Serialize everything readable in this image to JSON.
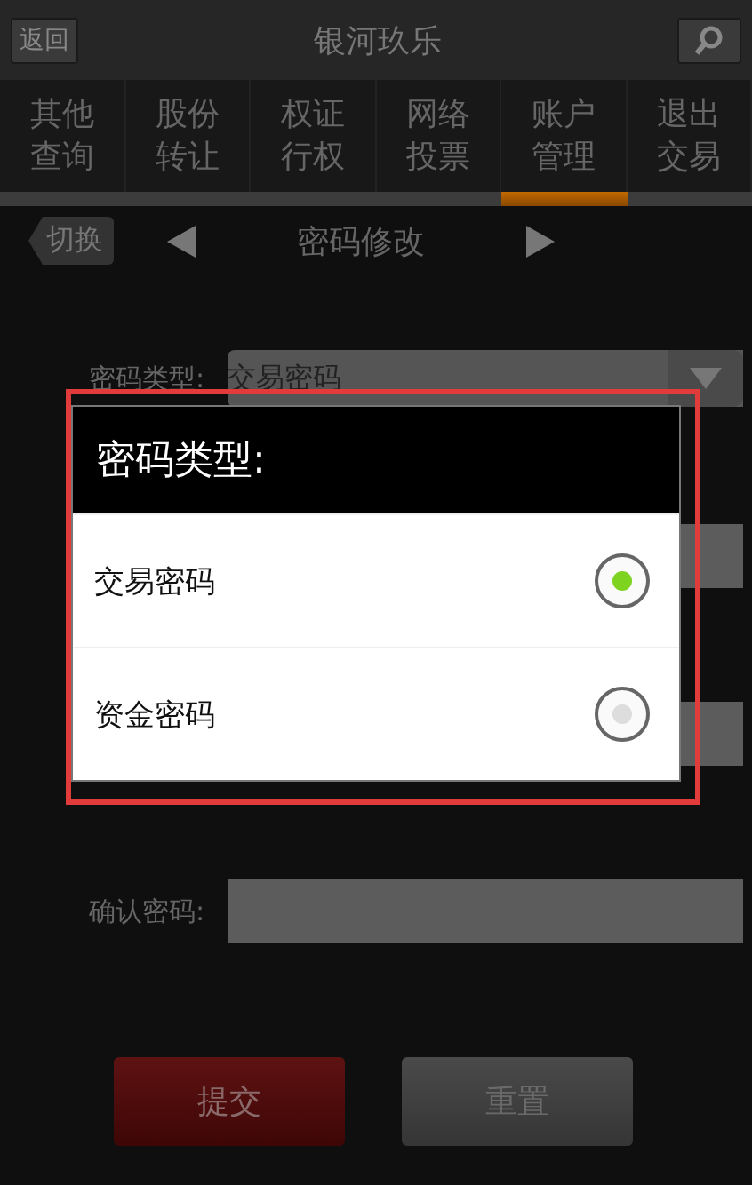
{
  "header": {
    "back_button": "返回",
    "title": "银河玖乐"
  },
  "tabs": [
    {
      "lines": [
        "其他",
        "查询"
      ],
      "selected": false
    },
    {
      "lines": [
        "股份",
        "转让"
      ],
      "selected": false
    },
    {
      "lines": [
        "权证",
        "行权"
      ],
      "selected": false
    },
    {
      "lines": [
        "网络",
        "投票"
      ],
      "selected": false
    },
    {
      "lines": [
        "账户",
        "管理"
      ],
      "selected": true
    },
    {
      "lines": [
        "退出",
        "交易"
      ],
      "selected": false
    }
  ],
  "subnav": {
    "switch_button": "切换",
    "title": "密码修改"
  },
  "form": {
    "fields": [
      {
        "kind": "select",
        "label": "密码类型:",
        "value": "交易密码"
      },
      {
        "kind": "input"
      },
      {
        "kind": "input"
      },
      {
        "kind": "input",
        "label": "确认密码:"
      }
    ]
  },
  "buttons": [
    {
      "kind": "primary",
      "label": "提交"
    },
    {
      "kind": "secondary",
      "label": "重置"
    }
  ],
  "dialog": {
    "title": "密码类型:",
    "options": [
      {
        "label": "交易密码",
        "selected": true
      },
      {
        "label": "资金密码",
        "selected": false
      }
    ]
  }
}
